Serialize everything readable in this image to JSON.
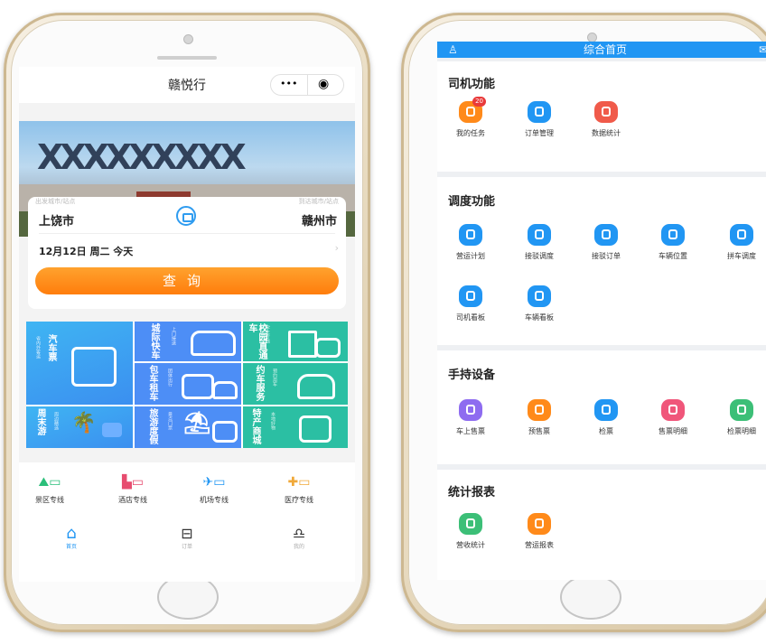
{
  "colors": {
    "blue": "#2196f3",
    "orange": "#ff8a1a",
    "red": "#f05a4a",
    "green": "#3cbf77",
    "purple": "#8e6cf0",
    "teal": "#2bbfa3"
  },
  "left_phone": {
    "mini_title": "赣悦行",
    "capsule_more": "•••",
    "capsule_close": "◉",
    "search": {
      "from_hint": "出发城市/站点",
      "to_hint": "到达城市/站点",
      "from_city": "上饶市",
      "to_city": "赣州市",
      "date": "12月12日 周二 今天",
      "query_label": "查询"
    },
    "tiles": [
      {
        "name": "汽车票",
        "sub": "省内外客运"
      },
      {
        "name": "城际快车",
        "sub": "上门接送"
      },
      {
        "name": "校园直通车",
        "sub": "学生专线"
      },
      {
        "name": "包车租车",
        "sub": "团体出行"
      },
      {
        "name": "约车服务",
        "sub": "预约用车"
      },
      {
        "name": "周末游",
        "sub": "周边精选"
      },
      {
        "name": "旅游度假",
        "sub": "景点门票"
      },
      {
        "name": "特产商城",
        "sub": "本地好物"
      }
    ],
    "services": [
      {
        "label": "景区专线",
        "icon": "scenic-bus-icon"
      },
      {
        "label": "酒店专线",
        "icon": "hotel-bus-icon"
      },
      {
        "label": "机场专线",
        "icon": "plane-bus-icon"
      },
      {
        "label": "医疗专线",
        "icon": "hospital-bus-icon"
      }
    ],
    "tabs": [
      {
        "label": "首页",
        "icon": "home-icon"
      },
      {
        "label": "订单",
        "icon": "order-icon"
      },
      {
        "label": "我的",
        "icon": "profile-icon"
      }
    ]
  },
  "right_phone": {
    "header_title": "综合首页",
    "sections": [
      {
        "title": "司机功能",
        "items": [
          {
            "label": "我的任务",
            "color": "#ff8a1a",
            "badge": "20"
          },
          {
            "label": "订单管理",
            "color": "#2196f3"
          },
          {
            "label": "数据统计",
            "color": "#f05a4a"
          }
        ]
      },
      {
        "title": "调度功能",
        "items": [
          {
            "label": "营运计划",
            "color": "#2196f3"
          },
          {
            "label": "接驳调度",
            "color": "#2196f3"
          },
          {
            "label": "接驳订单",
            "color": "#2196f3"
          },
          {
            "label": "车辆位置",
            "color": "#2196f3"
          },
          {
            "label": "拼车调度",
            "color": "#2196f3"
          },
          {
            "label": "司机看板",
            "color": "#2196f3"
          },
          {
            "label": "车辆看板",
            "color": "#2196f3"
          }
        ]
      },
      {
        "title": "手持设备",
        "items": [
          {
            "label": "车上售票",
            "color": "#8e6cf0"
          },
          {
            "label": "预售票",
            "color": "#ff8a1a"
          },
          {
            "label": "检票",
            "color": "#2196f3"
          },
          {
            "label": "售票明细",
            "color": "#f0567a"
          },
          {
            "label": "检票明细",
            "color": "#3cbf77"
          }
        ]
      },
      {
        "title": "统计报表",
        "items": [
          {
            "label": "营收统计",
            "color": "#3cbf77"
          },
          {
            "label": "营运报表",
            "color": "#ff8a1a"
          }
        ]
      }
    ]
  }
}
